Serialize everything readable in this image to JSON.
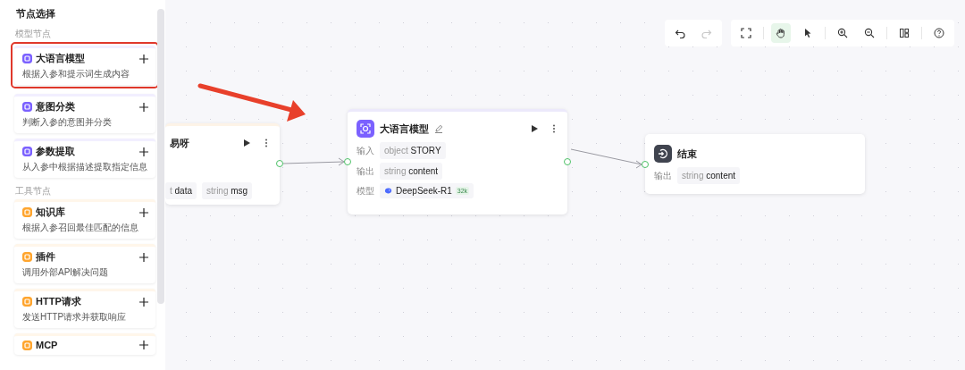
{
  "sidebar": {
    "title": "节点选择",
    "sections": [
      {
        "heading": "模型节点",
        "items": [
          {
            "title": "大语言模型",
            "description": "根据入参和提示词生成内容",
            "color": "#7b61ff",
            "highlighted": true
          },
          {
            "title": "意图分类",
            "description": "判断入参的意图并分类",
            "color": "#7b61ff",
            "highlighted": false
          },
          {
            "title": "参数提取",
            "description": "从入参中根据描述提取指定信息",
            "color": "#7b61ff",
            "highlighted": false
          }
        ]
      },
      {
        "heading": "工具节点",
        "items": [
          {
            "title": "知识库",
            "description": "根据入参召回最佳匹配的信息",
            "color": "#ffa52e",
            "highlighted": false
          },
          {
            "title": "插件",
            "description": "调用外部API解决问题",
            "color": "#ffa52e",
            "highlighted": false
          },
          {
            "title": "HTTP请求",
            "description": "发送HTTP请求并获取响应",
            "color": "#ffa52e",
            "highlighted": false
          },
          {
            "title": "MCP",
            "color": "#ffa52e",
            "highlighted": false
          }
        ]
      }
    ]
  },
  "canvas": {
    "toolbar": [
      [
        {
          "kind": "undo",
          "disabled": false,
          "selected": false
        },
        {
          "kind": "redo",
          "disabled": true,
          "selected": false
        }
      ],
      [
        {
          "kind": "fullscreen",
          "disabled": false,
          "selected": false
        },
        {
          "kind": "hand",
          "disabled": false,
          "selected": true
        },
        {
          "kind": "pointer",
          "disabled": false,
          "selected": false
        },
        {
          "kind": "zoom-in",
          "disabled": false,
          "selected": false
        },
        {
          "kind": "zoom-out",
          "disabled": false,
          "selected": false
        },
        {
          "kind": "layout",
          "disabled": false,
          "selected": false
        },
        {
          "kind": "help",
          "disabled": false,
          "selected": false
        }
      ]
    ],
    "nodes": [
      {
        "kind": "start",
        "title": "易呀",
        "rows": [
          {
            "chips": [
              {
                "type": "t",
                "name": "data"
              },
              {
                "type": "string",
                "name": "msg"
              }
            ]
          }
        ]
      },
      {
        "kind": "llm",
        "title": "大语言模型",
        "rows": [
          {
            "label": "输入",
            "chips": [
              {
                "type": "object",
                "name": "STORY"
              }
            ]
          },
          {
            "label": "输出",
            "chips": [
              {
                "type": "string",
                "name": "content"
              }
            ]
          },
          {
            "label": "模型",
            "model": {
              "name": "DeepSeek-R1",
              "badge": "32k"
            }
          }
        ]
      },
      {
        "kind": "end",
        "title": "结束",
        "rows": [
          {
            "label": "输出",
            "chips": [
              {
                "type": "string",
                "name": "content"
              }
            ]
          }
        ]
      }
    ],
    "annotation": {
      "kind": "arrow"
    }
  }
}
